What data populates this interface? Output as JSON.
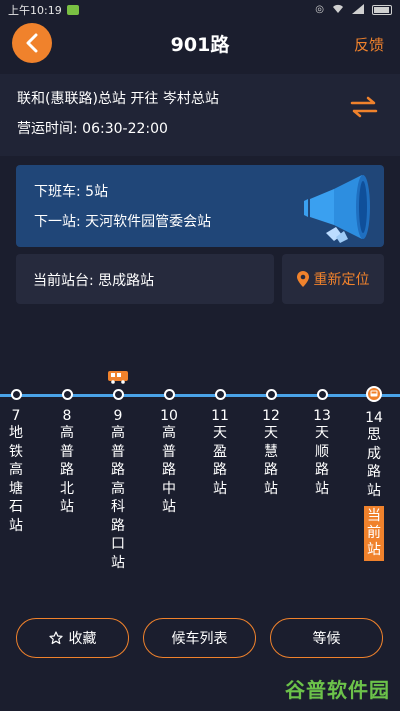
{
  "status_bar": {
    "time": "上午10:19"
  },
  "nav": {
    "title": "901路",
    "feedback_label": "反馈"
  },
  "route": {
    "direction": "联和(惠联路)总站 开往 岑村总站",
    "hours": "营运时间: 06:30-22:00"
  },
  "next_bus": {
    "next_bus_text": "下班车: 5站",
    "next_stop_text": "下一站: 天河软件园管委会站"
  },
  "current_stop": {
    "text": "当前站台: 思成路站",
    "relocate_label": "重新定位",
    "badge": "当前站"
  },
  "stops": [
    {
      "num": "7",
      "name": "地铁高塘石站"
    },
    {
      "num": "8",
      "name": "高普路北站"
    },
    {
      "num": "9",
      "name": "高普路高科路口站"
    },
    {
      "num": "10",
      "name": "高普路中站"
    },
    {
      "num": "11",
      "name": "天盈路站"
    },
    {
      "num": "12",
      "name": "天慧路站"
    },
    {
      "num": "13",
      "name": "天顺路站"
    },
    {
      "num": "14",
      "name": "思成路站"
    }
  ],
  "actions": {
    "favorite_label": "收藏",
    "wait_list_label": "候车列表",
    "wait_label": "等候"
  },
  "watermark": "谷普软件园",
  "colors": {
    "background": "#1b1e2e",
    "accent": "#f0822c",
    "route_line": "#4aa3e8",
    "card_blue": "#204678"
  }
}
